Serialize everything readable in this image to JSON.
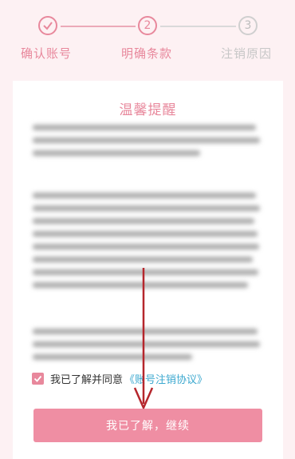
{
  "steps": [
    {
      "label": "确认账号",
      "number": "1",
      "status": "done"
    },
    {
      "label": "明确条款",
      "number": "2",
      "status": "current"
    },
    {
      "label": "注销原因",
      "number": "3",
      "status": "pending"
    }
  ],
  "card": {
    "title": "温馨提醒"
  },
  "agreement": {
    "text": "我已了解并同意",
    "link": "《账号注销协议》",
    "checked": true
  },
  "continue_button": {
    "label": "我已了解，继续"
  },
  "colors": {
    "accent": "#e8889c",
    "button": "#ef8ea3",
    "link": "#3ba8cf",
    "annotation_arrow": "#b5262c"
  }
}
